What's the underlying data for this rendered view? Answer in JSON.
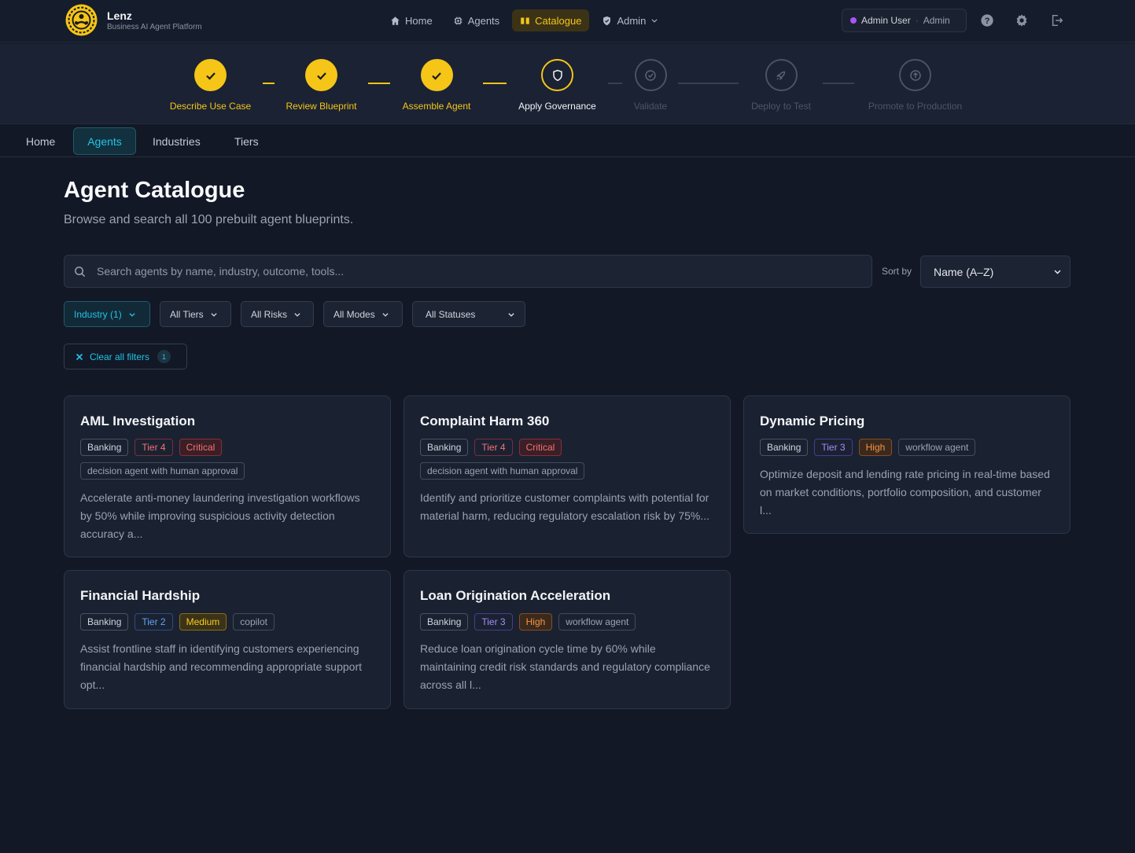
{
  "app": {
    "name": "Lenz",
    "subtitle": "Business AI Agent Platform"
  },
  "nav": {
    "items": [
      {
        "label": "Home",
        "icon": "home-icon"
      },
      {
        "label": "Agents",
        "icon": "chip-icon"
      },
      {
        "label": "Catalogue",
        "icon": "book-icon",
        "active": true
      },
      {
        "label": "Admin",
        "icon": "shield-icon"
      }
    ],
    "user": {
      "name": "Admin User",
      "separator": "·",
      "role": "Admin"
    }
  },
  "stepper": {
    "steps": [
      {
        "label": "Describe Use Case",
        "state": "done"
      },
      {
        "label": "Review Blueprint",
        "state": "done"
      },
      {
        "label": "Assemble Agent",
        "state": "done"
      },
      {
        "label": "Apply Governance",
        "state": "current"
      },
      {
        "label": "Validate",
        "state": "todo"
      },
      {
        "label": "Deploy to Test",
        "state": "todo"
      },
      {
        "label": "Promote to Production",
        "state": "todo"
      }
    ]
  },
  "subtabs": [
    {
      "label": "Home"
    },
    {
      "label": "Agents",
      "active": true
    },
    {
      "label": "Industries"
    },
    {
      "label": "Tiers"
    }
  ],
  "page": {
    "title": "Agent Catalogue",
    "subtitle": "Browse and search all 100 prebuilt agent blueprints."
  },
  "search": {
    "placeholder": "Search agents by name, industry, outcome, tools..."
  },
  "sort": {
    "label": "Sort by",
    "value": "Name (A–Z)"
  },
  "filters": {
    "industry": "Industry (1)",
    "tiers": "All Tiers",
    "risks": "All Risks",
    "modes": "All Modes",
    "statuses": "All Statuses"
  },
  "clear": {
    "label": "Clear all filters",
    "count": "1"
  },
  "colors": {
    "accent": "#f5c518",
    "cyan": "#22c3e6",
    "background": "#121826"
  },
  "cards": [
    {
      "title": "AML Investigation",
      "industry": "Banking",
      "tier": "Tier 4",
      "risk": "Critical",
      "mode": "decision agent with human approval",
      "description": "Accelerate anti-money laundering investigation workflows by 50% while improving suspicious activity detection accuracy a..."
    },
    {
      "title": "Complaint Harm 360",
      "industry": "Banking",
      "tier": "Tier 4",
      "risk": "Critical",
      "mode": "decision agent with human approval",
      "description": "Identify and prioritize customer complaints with potential for material harm, reducing regulatory escalation risk by 75%..."
    },
    {
      "title": "Dynamic Pricing",
      "industry": "Banking",
      "tier": "Tier 3",
      "risk": "High",
      "mode": "workflow agent",
      "description": "Optimize deposit and lending rate pricing in real-time based on market conditions, portfolio composition, and customer l..."
    },
    {
      "title": "Financial Hardship",
      "industry": "Banking",
      "tier": "Tier 2",
      "risk": "Medium",
      "mode": "copilot",
      "description": "Assist frontline staff in identifying customers experiencing financial hardship and recommending appropriate support opt..."
    },
    {
      "title": "Loan Origination Acceleration",
      "industry": "Banking",
      "tier": "Tier 3",
      "risk": "High",
      "mode": "workflow agent",
      "description": "Reduce loan origination cycle time by 60% while maintaining credit risk standards and regulatory compliance across all l..."
    }
  ]
}
